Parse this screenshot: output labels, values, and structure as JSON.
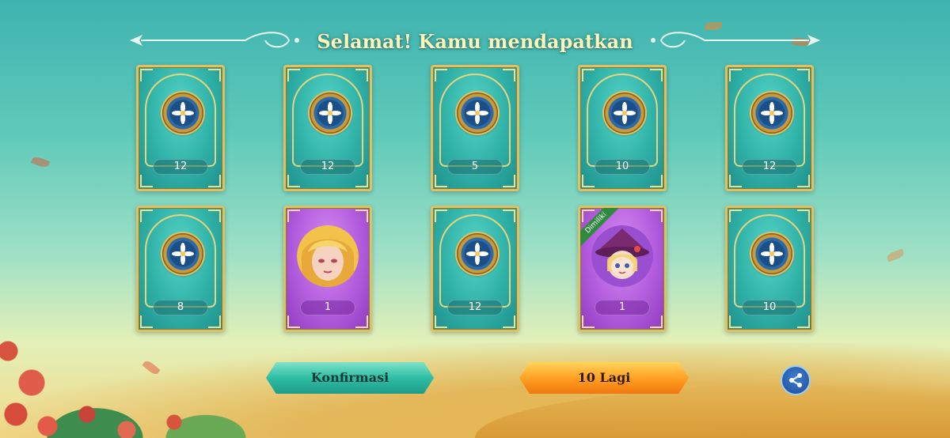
{
  "header": {
    "title": "Selamat! Kamu mendapatkan"
  },
  "rewards": [
    {
      "type": "token",
      "quantity": "12",
      "owned_label": ""
    },
    {
      "type": "token",
      "quantity": "12",
      "owned_label": ""
    },
    {
      "type": "token",
      "quantity": "5",
      "owned_label": ""
    },
    {
      "type": "token",
      "quantity": "10",
      "owned_label": ""
    },
    {
      "type": "token",
      "quantity": "12",
      "owned_label": ""
    },
    {
      "type": "token",
      "quantity": "8",
      "owned_label": ""
    },
    {
      "type": "character-portrait",
      "quantity": "1",
      "owned_label": ""
    },
    {
      "type": "token",
      "quantity": "12",
      "owned_label": ""
    },
    {
      "type": "character-portrait",
      "quantity": "1",
      "owned_label": "Dimiliki"
    },
    {
      "type": "token",
      "quantity": "10",
      "owned_label": ""
    }
  ],
  "actions": {
    "confirm_label": "Konfirmasi",
    "more_label": "10 Lagi",
    "share_icon": "share-icon"
  },
  "colors": {
    "card_teal": "#2fb0a6",
    "card_purple": "#b35cde",
    "frame_gold": "#d9c36a",
    "confirm_green": "#2ebda4",
    "more_orange": "#ff9d1f",
    "title_text": "#fff6b8"
  }
}
